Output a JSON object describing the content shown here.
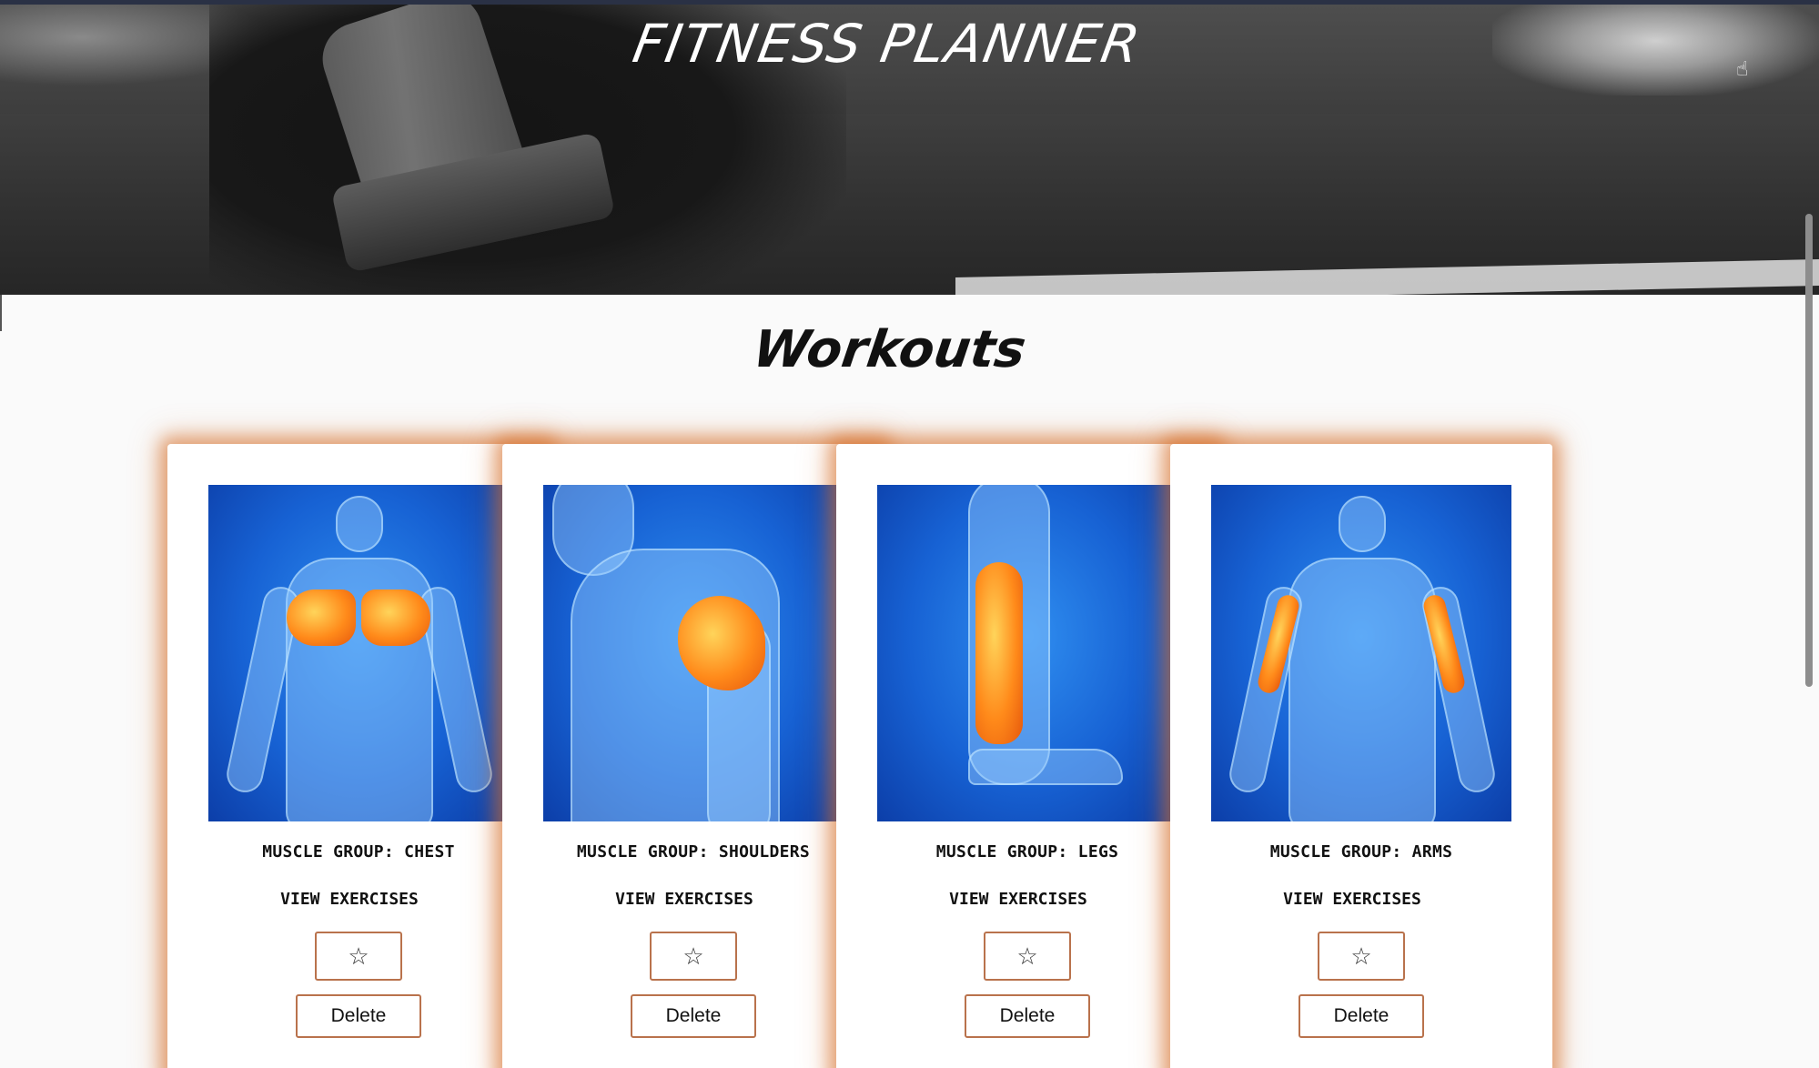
{
  "header": {
    "title": "FITNESS PLANNER"
  },
  "section": {
    "title": "Workouts"
  },
  "workouts": [
    {
      "group_label": "MUSCLE GROUP: CHEST",
      "view_label": "VIEW EXERCISES",
      "star": "☆",
      "delete_label": "Delete",
      "image": "chest-anatomy-illustration"
    },
    {
      "group_label": "MUSCLE GROUP: SHOULDERS",
      "view_label": "VIEW EXERCISES",
      "star": "☆",
      "delete_label": "Delete",
      "image": "shoulder-anatomy-illustration"
    },
    {
      "group_label": "MUSCLE GROUP: LEGS",
      "view_label": "VIEW EXERCISES",
      "star": "☆",
      "delete_label": "Delete",
      "image": "leg-anatomy-illustration"
    },
    {
      "group_label": "MUSCLE GROUP: ARMS",
      "view_label": "VIEW EXERCISES",
      "star": "☆",
      "delete_label": "Delete",
      "image": "arm-anatomy-illustration"
    }
  ],
  "colors": {
    "card_glow": "#d66e28",
    "button_border": "#b9724c",
    "image_blue": "#1762d4",
    "muscle_orange": "#ff8a1a"
  }
}
